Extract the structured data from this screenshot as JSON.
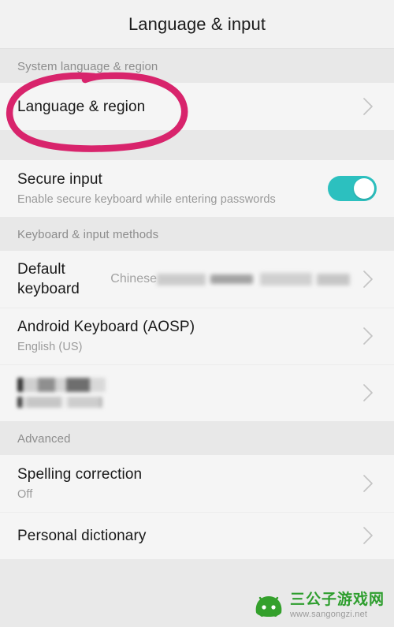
{
  "header": {
    "title": "Language & input"
  },
  "sections": [
    {
      "name": "system-language-region",
      "header": "System language & region",
      "rows": [
        {
          "name": "language-and-region",
          "primary": "Language & region",
          "secondary": "",
          "value": "",
          "accessory": "chevron"
        }
      ]
    },
    {
      "name": "secure-input",
      "header": "",
      "rows": [
        {
          "name": "secure-input",
          "primary": "Secure input",
          "secondary": "Enable secure keyboard while entering passwords",
          "value": "",
          "accessory": "toggle",
          "toggle_on": true
        }
      ]
    },
    {
      "name": "keyboard-input-methods",
      "header": "Keyboard & input methods",
      "rows": [
        {
          "name": "default-keyboard",
          "primary": "Default keyboard",
          "secondary": "",
          "value": "Chinese",
          "value_redacted": true,
          "accessory": "chevron"
        },
        {
          "name": "android-keyboard-aosp",
          "primary": "Android Keyboard (AOSP)",
          "secondary": "English (US)",
          "value": "",
          "accessory": "chevron"
        },
        {
          "name": "redacted-input-method",
          "primary": "",
          "secondary": "",
          "value": "",
          "redacted": true,
          "accessory": "chevron"
        }
      ]
    },
    {
      "name": "advanced",
      "header": "Advanced",
      "rows": [
        {
          "name": "spelling-correction",
          "primary": "Spelling correction",
          "secondary": "Off",
          "value": "",
          "accessory": "chevron"
        },
        {
          "name": "personal-dictionary",
          "primary": "Personal dictionary",
          "secondary": "",
          "value": "",
          "accessory": "chevron"
        }
      ]
    }
  ],
  "annotation": {
    "name": "highlight-circle",
    "shape": "hand-drawn-ellipse",
    "color": "#d8246c",
    "targets": "Language & region"
  },
  "watermark": {
    "site_name": "三公子游戏网",
    "url": "www.sangongzi.net",
    "logo_color": "#34a02c"
  },
  "colors": {
    "toggle_on": "#2cc0bf",
    "section_band": "#e8e8e8",
    "row_background": "#f5f5f5",
    "titlebar_background": "#f2f2f2",
    "primary_text": "#191919",
    "secondary_text": "#9a9a9a",
    "annotation_pink": "#d8246c"
  }
}
